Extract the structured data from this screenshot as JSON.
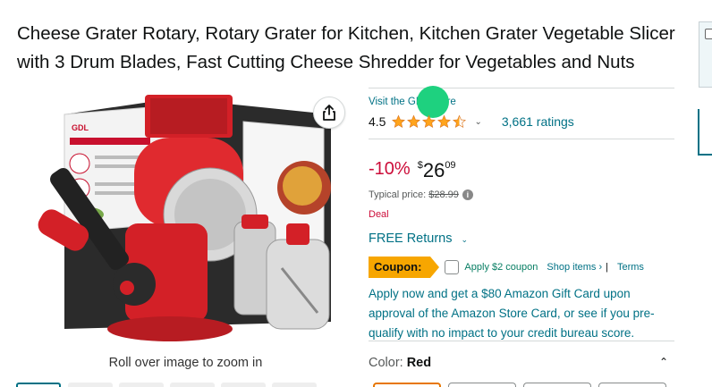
{
  "product": {
    "title": "Cheese Grater Rotary, Rotary Grater for Kitchen, Kitchen Grater Vegetable Slicer with 3 Drum Blades, Fast Cutting Cheese Shredder for Vegetables and Nuts",
    "box_brand": "GDL",
    "zoom_hint": "Roll over image to zoom in"
  },
  "store": {
    "link_text": "Visit the GDL Store"
  },
  "rating": {
    "value": "4.5",
    "stars": 4.5,
    "count_text": "3,661 ratings"
  },
  "price": {
    "discount": "-10%",
    "currency": "$",
    "whole": "26",
    "fraction": "09",
    "typical_label": "Typical price:",
    "typical_value": "$28.99",
    "deal_label": "Deal"
  },
  "returns": {
    "label": "FREE Returns"
  },
  "coupon": {
    "tag": "Coupon:",
    "apply_text": "Apply $2 coupon",
    "shop_items": "Shop items ›",
    "separator": "|",
    "terms": "Terms"
  },
  "promo": {
    "text": "Apply now and get a $80 Amazon Gift Card upon approval of the Amazon Store Card, or see if you pre-qualify with no impact to your credit bureau score."
  },
  "color": {
    "label": "Color:",
    "value": "Red"
  },
  "colors": {
    "link": "#007185",
    "price_red": "#cc0c39",
    "coupon": "#f7a600",
    "star": "#ffa41c",
    "dot": "#1ed17f"
  }
}
